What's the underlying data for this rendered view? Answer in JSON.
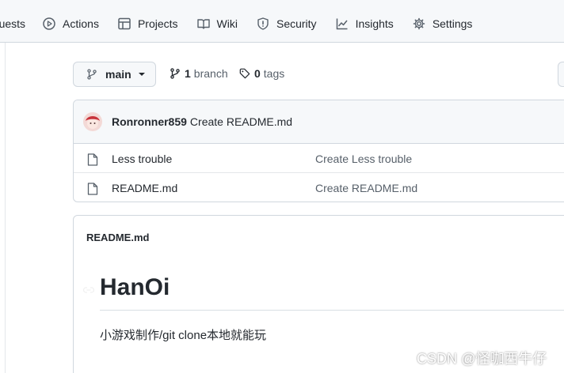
{
  "nav": {
    "items": [
      {
        "label": "equests",
        "icon": "pull-request-icon"
      },
      {
        "label": "Actions",
        "icon": "play-icon"
      },
      {
        "label": "Projects",
        "icon": "table-icon"
      },
      {
        "label": "Wiki",
        "icon": "book-icon"
      },
      {
        "label": "Security",
        "icon": "shield-icon"
      },
      {
        "label": "Insights",
        "icon": "graph-icon"
      },
      {
        "label": "Settings",
        "icon": "gear-icon"
      }
    ]
  },
  "repo": {
    "branch_button": "main",
    "branch_count": "1",
    "branch_label": "branch",
    "tag_count": "0",
    "tag_label": "tags"
  },
  "commit": {
    "author": "Ronronner859",
    "message": "Create README.md"
  },
  "files": [
    {
      "name": "Less trouble",
      "message": "Create Less trouble",
      "icon": "file-icon"
    },
    {
      "name": "README.md",
      "message": "Create README.md",
      "icon": "file-icon"
    }
  ],
  "readme": {
    "title": "README.md",
    "heading": "HanOi",
    "text": "小游戏制作/git clone本地就能玩"
  },
  "watermark": "CSDN @怪咖西牛仔",
  "colors": {
    "border": "#d0d7de",
    "header_bg": "#f6f8fa",
    "text": "#24292f",
    "muted": "#57606a"
  }
}
